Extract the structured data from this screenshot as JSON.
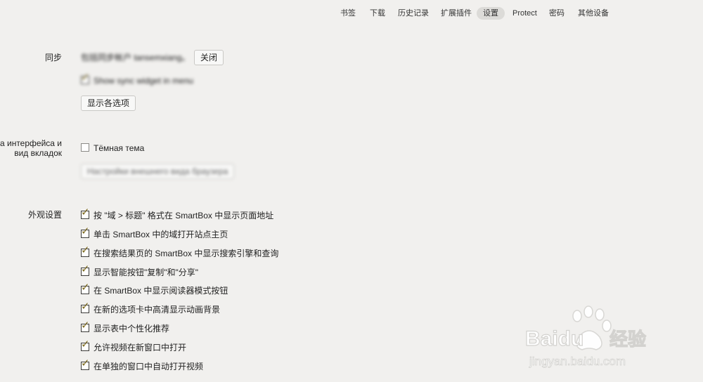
{
  "nav": {
    "items": [
      {
        "label": "书签"
      },
      {
        "label": "下载"
      },
      {
        "label": "历史记录"
      },
      {
        "label": "扩展插件"
      },
      {
        "label": "设置"
      },
      {
        "label": "Protect"
      },
      {
        "label": "密码"
      },
      {
        "label": "其他设备"
      }
    ],
    "active_index": 4
  },
  "sync": {
    "label": "同步",
    "account_text": "包括同步帐户 tansemxiang。",
    "close_button": "关闭",
    "widget_checkbox": {
      "label": "Show sync widget in menu",
      "checked": true
    },
    "show_options_button": "显示各选项"
  },
  "theme": {
    "label_line1": "ма интерфейса и",
    "label_line2": "вид вкладок",
    "dark_theme": {
      "label": "Тёмная тема",
      "checked": false
    },
    "appearance_button": "Настройки внешнего вида браузера"
  },
  "appearance": {
    "label": "外观设置",
    "options": [
      {
        "label": "按 \"域 > 标题\" 格式在 SmartBox 中显示页面地址",
        "checked": true
      },
      {
        "label": "单击 SmartBox 中的域打开站点主页",
        "checked": true
      },
      {
        "label": "在搜索结果页的 SmartBox 中显示搜索引擎和查询",
        "checked": true
      },
      {
        "label": "显示智能按钮\"复制\"和\"分享\"",
        "checked": true
      },
      {
        "label": "在 SmartBox 中显示阅读器模式按钮",
        "checked": true
      },
      {
        "label": "在新的选项卡中高清显示动画背景",
        "checked": true
      },
      {
        "label": "显示表中个性化推荐",
        "checked": true
      },
      {
        "label": "允许视频在新窗口中打开",
        "checked": true
      },
      {
        "label": "在单独的窗口中自动打开视频",
        "checked": true
      }
    ]
  },
  "watermark": {
    "brand": "Baidu",
    "brand_cn": "经验",
    "url": "jingyan.baidu.com"
  },
  "colors": {
    "background": "#f1f0ee",
    "checkmark": "#7d6a1f",
    "active_tab": "#dcdbd8"
  }
}
